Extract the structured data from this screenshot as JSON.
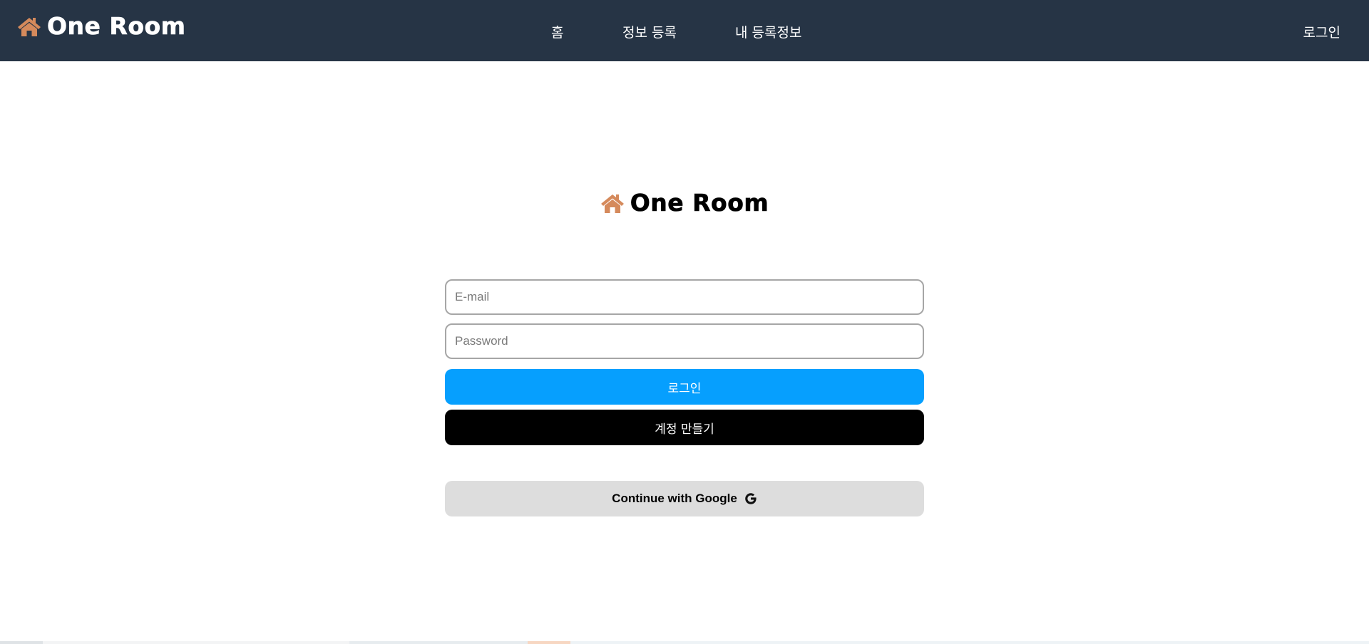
{
  "header": {
    "brand_title": "One Room",
    "nav_items": [
      {
        "label": "홈"
      },
      {
        "label": "정보 등록"
      },
      {
        "label": "내 등록정보"
      }
    ],
    "login_label": "로그인"
  },
  "main": {
    "logo_title": "One Room",
    "email_placeholder": "E-mail",
    "password_placeholder": "Password",
    "login_button": "로그인",
    "signup_button": "계정 만들기",
    "google_button": "Continue with Google"
  },
  "colors": {
    "header_bg": "#263445",
    "brand_icon": "#d58a5c",
    "login_button": "#069ffe",
    "signup_button": "#000000",
    "google_button": "#dddddd"
  },
  "icons": {
    "brand": "house-icon",
    "google": "google-g-icon"
  }
}
